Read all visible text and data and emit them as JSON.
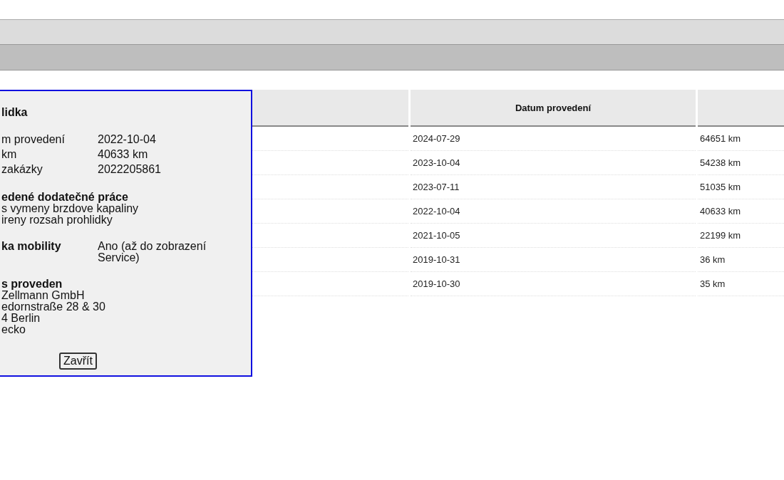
{
  "table": {
    "date_header": "Datum provedení",
    "rows": [
      {
        "date": "2024-07-29",
        "mileage": "64651 km"
      },
      {
        "date": "2023-10-04",
        "mileage": "54238 km"
      },
      {
        "date": "2023-07-11",
        "mileage": "51035 km"
      },
      {
        "date": "2022-10-04",
        "mileage": "40633 km"
      },
      {
        "date": "2021-10-05",
        "mileage": "22199 km"
      },
      {
        "date": "2019-10-31",
        "mileage": "36 km"
      },
      {
        "date": "2019-10-30",
        "mileage": "35 km"
      }
    ]
  },
  "popup": {
    "title": "lidka",
    "fields": [
      {
        "label": "m provedení",
        "value": "2022-10-04"
      },
      {
        "label": "km",
        "value": "40633 km"
      },
      {
        "label": " zakázky",
        "value": "2022205861"
      }
    ],
    "sections": [
      {
        "kind": "list",
        "heading": "edené dodatečné práce",
        "lines": [
          "s vymeny brzdove kapaliny",
          "ireny rozsah prohlidky"
        ]
      },
      {
        "kind": "pair",
        "heading": "ka mobility",
        "value": "Ano (až do zobrazení Service)"
      },
      {
        "kind": "list",
        "heading": "s proveden",
        "lines": [
          "Zellmann GmbH",
          "edornstraße 28 & 30",
          "4 Berlin",
          "ecko"
        ]
      }
    ],
    "button": "Zavřít"
  }
}
